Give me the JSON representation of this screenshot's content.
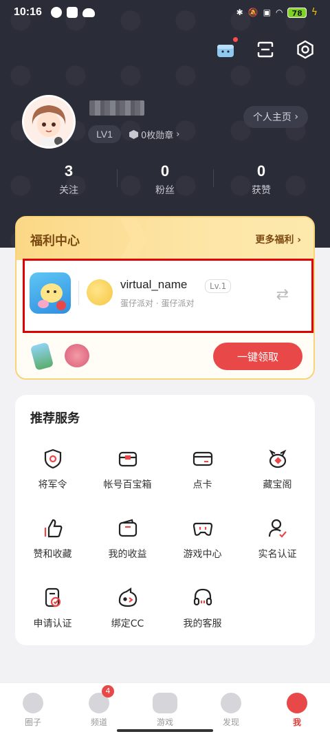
{
  "status_bar": {
    "time": "10:16",
    "battery": "78"
  },
  "profile": {
    "level": "LV1",
    "medals": "0枚勋章",
    "homepage_button": "个人主页"
  },
  "stats": [
    {
      "value": "3",
      "label": "关注"
    },
    {
      "value": "0",
      "label": "粉丝"
    },
    {
      "value": "0",
      "label": "获赞"
    }
  ],
  "welfare": {
    "title": "福利中心",
    "more": "更多福利",
    "game": {
      "name": "virtual_name",
      "level": "Lv.1",
      "subtitle": "蛋仔派对 · 蛋仔派对"
    },
    "claim_button": "一键领取"
  },
  "services": {
    "title": "推荐服务",
    "items": [
      {
        "label": "将军令",
        "icon": "shield-icon"
      },
      {
        "label": "帐号百宝箱",
        "icon": "treasure-box-icon"
      },
      {
        "label": "点卡",
        "icon": "card-icon"
      },
      {
        "label": "藏宝阁",
        "icon": "treasure-pavilion-icon"
      },
      {
        "label": "赞和收藏",
        "icon": "thumbs-up-icon"
      },
      {
        "label": "我的收益",
        "icon": "wallet-icon"
      },
      {
        "label": "游戏中心",
        "icon": "gamepad-icon"
      },
      {
        "label": "实名认证",
        "icon": "user-verify-icon"
      },
      {
        "label": "申请认证",
        "icon": "document-check-icon"
      },
      {
        "label": "绑定CC",
        "icon": "cc-mascot-icon"
      },
      {
        "label": "我的客服",
        "icon": "headset-icon"
      }
    ]
  },
  "tabbar": {
    "items": [
      {
        "label": "圈子",
        "icon": "circle-icon"
      },
      {
        "label": "频道",
        "icon": "channel-icon",
        "badge": "4"
      },
      {
        "label": "游戏",
        "icon": "game-icon"
      },
      {
        "label": "发现",
        "icon": "planet-icon"
      },
      {
        "label": "我",
        "icon": "me-icon",
        "active": true
      }
    ]
  }
}
